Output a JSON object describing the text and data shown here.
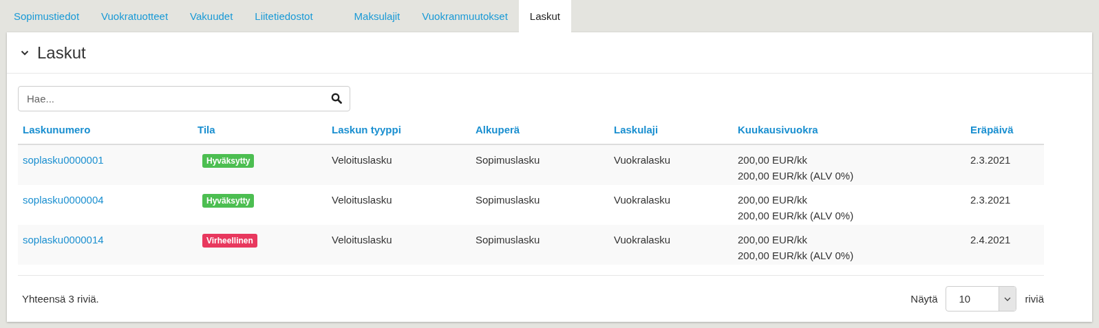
{
  "tabs": [
    {
      "label": "Sopimustiedot",
      "selected": false
    },
    {
      "label": "Vuokratuotteet",
      "selected": false
    },
    {
      "label": "Vakuudet",
      "selected": false
    },
    {
      "label": "Liitetiedostot",
      "selected": false
    },
    {
      "label": "Maksulajit",
      "selected": false
    },
    {
      "label": "Vuokranmuutokset",
      "selected": false
    },
    {
      "label": "Laskut",
      "selected": true
    }
  ],
  "panel": {
    "title": "Laskut",
    "expanded": true
  },
  "search": {
    "placeholder": "Hae..."
  },
  "table": {
    "columns": [
      "Laskunumero",
      "Tila",
      "Laskun tyyppi",
      "Alkuperä",
      "Laskulaji",
      "Kuukausivuokra",
      "Eräpäivä"
    ],
    "rows": [
      {
        "number": "soplasku0000001",
        "status": "Hyväksytty",
        "color": "#4cbe51",
        "type": "Veloituslasku",
        "origin": "Sopimuslasku",
        "category": "Vuokralasku",
        "rent": [
          "200,00 EUR/kk",
          "200,00 EUR/kk (ALV 0%)"
        ],
        "due": "2.3.2021"
      },
      {
        "number": "soplasku0000004",
        "status": "Hyväksytty",
        "color": "#4cbe51",
        "type": "Veloituslasku",
        "origin": "Sopimuslasku",
        "category": "Vuokralasku",
        "rent": [
          "200,00 EUR/kk",
          "200,00 EUR/kk (ALV 0%)"
        ],
        "due": "2.3.2021"
      },
      {
        "number": "soplasku0000014",
        "status": "Virheellinen",
        "color": "#e8385e",
        "type": "Veloituslasku",
        "origin": "Sopimuslasku",
        "category": "Vuokralasku",
        "rent": [
          "200,00 EUR/kk",
          "200,00 EUR/kk (ALV 0%)"
        ],
        "due": "2.4.2021"
      }
    ]
  },
  "footer": {
    "total": "Yhteensä 3 riviä.",
    "show_label": "Näytä",
    "page_size": "10",
    "rows_label": "riviä"
  }
}
